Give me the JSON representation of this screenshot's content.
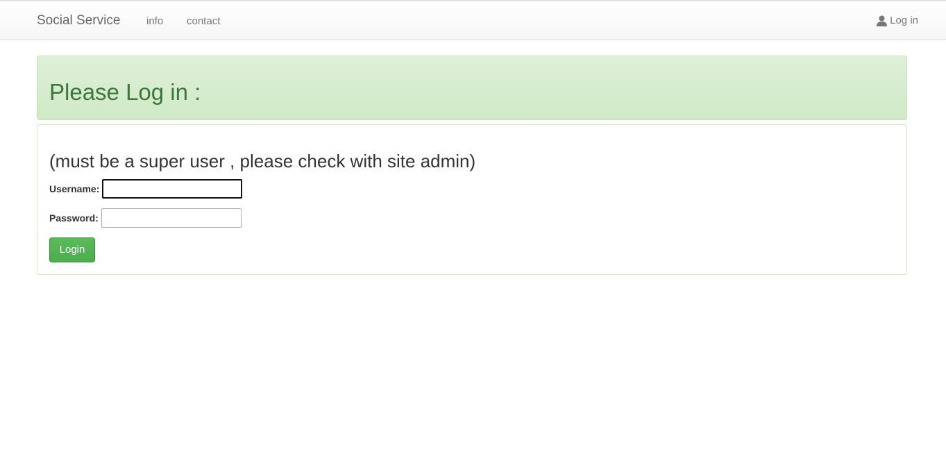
{
  "navbar": {
    "brand": "Social Service",
    "links": [
      {
        "label": "info"
      },
      {
        "label": "contact"
      }
    ],
    "login": {
      "label": "Log in",
      "icon": "user-icon"
    }
  },
  "alert": {
    "heading": "Please Log in :",
    "colors": {
      "background": "#dff0d8",
      "text": "#3c763d"
    }
  },
  "login_form": {
    "note": "(must be a super user , please check with site admin)",
    "username": {
      "label": "Username:",
      "value": "",
      "focused": true
    },
    "password": {
      "label": "Password:",
      "value": ""
    },
    "submit_label": "Login",
    "submit_color": "#5cb85c"
  }
}
